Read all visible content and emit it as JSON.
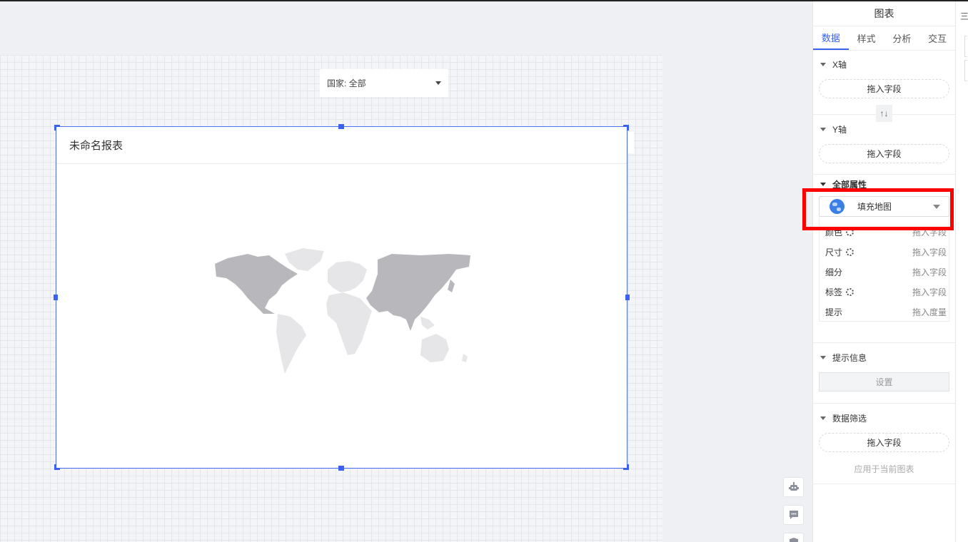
{
  "canvas": {
    "filter_label": "国家: 全部",
    "widget_title": "未命名报表"
  },
  "panel": {
    "title": "图表",
    "tabs": [
      "数据",
      "样式",
      "分析",
      "交互"
    ],
    "active_tab": "数据",
    "x_axis": {
      "label": "X轴",
      "drop": "拖入字段"
    },
    "y_axis": {
      "label": "Y轴",
      "drop": "拖入字段"
    },
    "swap_glyph": "↑↓",
    "all_props": {
      "label": "全部属性",
      "chart_type": "填充地图",
      "rows": [
        {
          "name": "颜色",
          "value": "拖入字段",
          "gear": true
        },
        {
          "name": "尺寸",
          "value": "拖入字段",
          "gear": true
        },
        {
          "name": "细分",
          "value": "拖入字段",
          "gear": false
        },
        {
          "name": "标签",
          "value": "拖入字段",
          "gear": true
        },
        {
          "name": "提示",
          "value": "拖入度量",
          "gear": false
        }
      ]
    },
    "tooltip_info": {
      "label": "提示信息",
      "button": "设置"
    },
    "data_filter": {
      "label": "数据筛选",
      "drop": "拖入字段",
      "hint": "应用于当前图表"
    }
  },
  "colors": {
    "accent": "#3a62f0",
    "highlight": "#ff0000",
    "map_dark": "#b8b8bc",
    "map_light": "#e6e6e8"
  },
  "icons": [
    "robot-icon",
    "chat-icon",
    "shield-icon",
    "globe-icon",
    "gear-icon",
    "swap-icon"
  ]
}
